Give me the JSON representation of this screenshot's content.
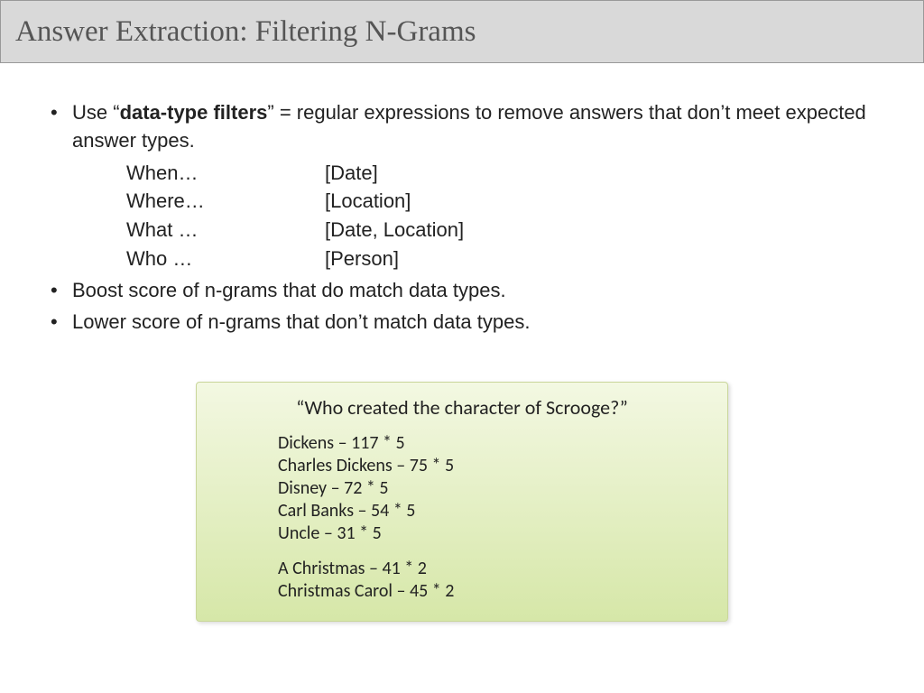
{
  "title": "Answer Extraction: Filtering N-Grams",
  "bullets": {
    "b1_pre": "Use “",
    "b1_bold": "data-type filters",
    "b1_post": "” = regular expressions to remove answers that don’t meet expected answer types.",
    "b2": "Boost score of  n-grams that do match data types.",
    "b3": "Lower score of n-grams that don’t match data types."
  },
  "filters": [
    {
      "q": "When…",
      "t": "[Date]"
    },
    {
      "q": "Where…",
      "t": "[Location]"
    },
    {
      "q": "What …",
      "t": "[Date, Location]"
    },
    {
      "q": "Who …",
      "t": "[Person]"
    }
  ],
  "example": {
    "question": "“Who created the character of Scrooge?”",
    "group1": [
      "Dickens – 117 * 5",
      "Charles Dickens – 75 * 5",
      "Disney – 72 * 5",
      "Carl Banks – 54 * 5",
      "Uncle – 31 * 5"
    ],
    "group2": [
      "A Christmas – 41 * 2",
      "Christmas Carol – 45 * 2"
    ]
  }
}
